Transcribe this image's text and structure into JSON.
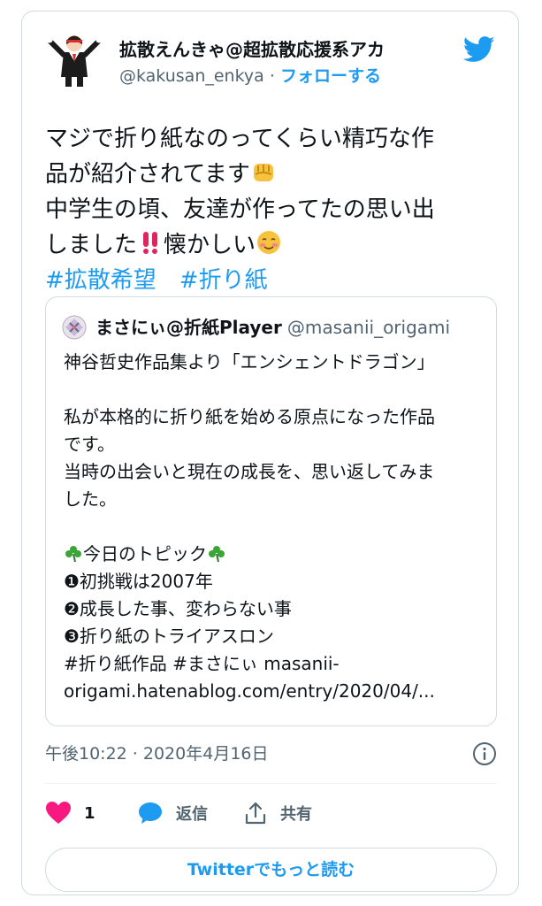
{
  "author": {
    "display_name": "拡散えんきゃ@超拡散応援系アカ",
    "handle": "@kakusan_enkya",
    "separator": "·",
    "follow_label": "フォローする"
  },
  "tweet": {
    "lines": [
      "マジで折り紙なのってくらい精巧な作",
      "品が紹介されてます",
      "中学生の頃、友達が作ってたの思い出",
      "しました",
      "懐かしい"
    ],
    "hashtags": [
      "#拡散希望",
      "#折り紙"
    ]
  },
  "quote": {
    "display_name": "まさにぃ@折紙Player",
    "handle": "@masanii_origami",
    "lines": [
      "神谷哲史作品集より「エンシェントドラゴン」",
      "",
      "私が本格的に折り紙を始める原点になった作品",
      "です。",
      "当時の出会いと現在の成長を、思い返してみま",
      "した。",
      "",
      "今日のトピック",
      "❶初挑戦は2007年",
      "❷成長した事、変わらない事",
      "❸折り紙のトライアスロン",
      "#折り紙作品 #まさにぃ masanii-",
      "origami.hatenablog.com/entry/2020/04/..."
    ]
  },
  "meta": {
    "timestamp": "午後10:22 · 2020年4月16日"
  },
  "actions": {
    "like_count": "1",
    "reply_label": "返信",
    "share_label": "共有"
  },
  "more_button_label": "Twitterでもっと読む",
  "colors": {
    "accent": "#1d9bf0",
    "like": "#f91880",
    "text": "#0f1419",
    "muted": "#536471",
    "border": "#cfd9de"
  },
  "icons": {
    "brand": "bird-logo-icon",
    "like": "heart-icon",
    "reply": "speech-bubble-icon",
    "share": "share-icon",
    "info": "info-icon"
  }
}
